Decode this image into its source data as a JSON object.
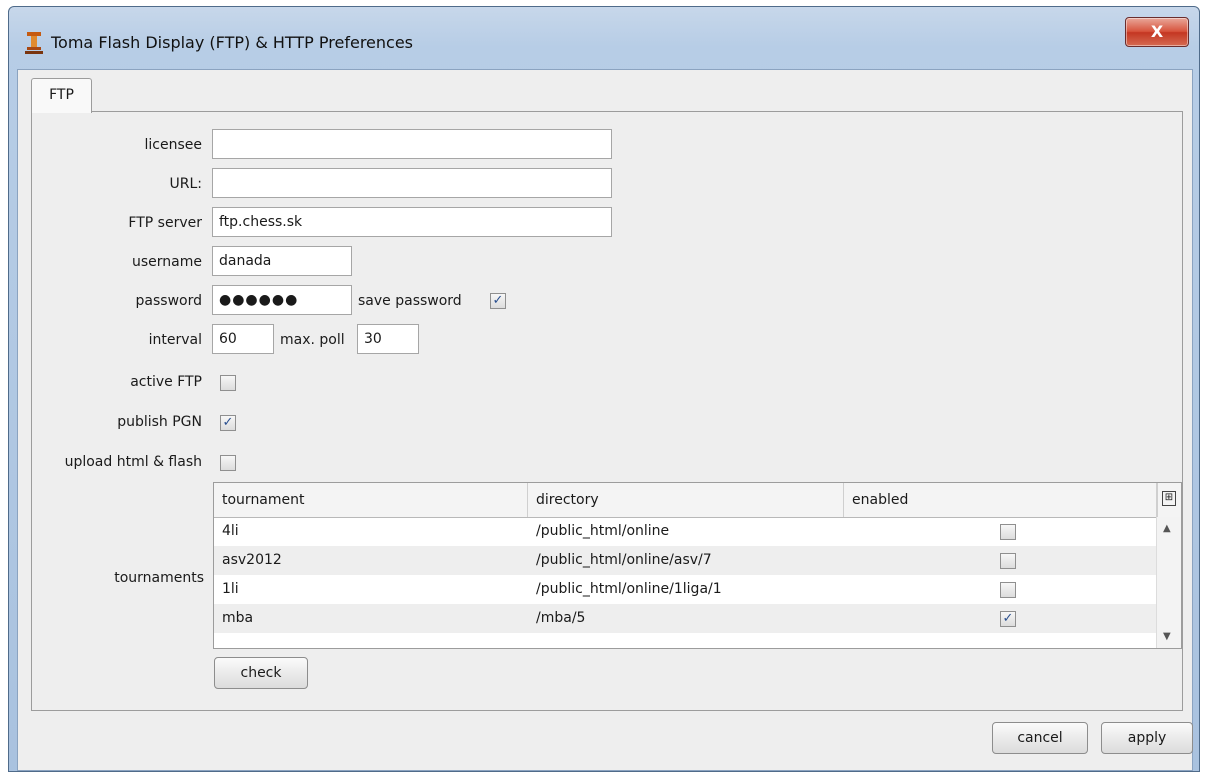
{
  "window": {
    "title": "Toma Flash Display (FTP) & HTTP Preferences",
    "close_label": "X"
  },
  "tabs": [
    {
      "label": "FTP"
    }
  ],
  "form": {
    "licensee_label": "licensee",
    "licensee_value": "",
    "url_label": "URL:",
    "url_value": "",
    "ftp_server_label": "FTP server",
    "ftp_server_value": "ftp.chess.sk",
    "username_label": "username",
    "username_value": "danada",
    "password_label": "password",
    "password_value": "●●●●●●",
    "save_password_label": "save password",
    "save_password_checked": true,
    "interval_label": "interval",
    "interval_value": "60",
    "max_poll_label": "max. poll",
    "max_poll_value": "30",
    "active_ftp_label": "active FTP",
    "active_ftp_checked": false,
    "publish_pgn_label": "publish PGN",
    "publish_pgn_checked": true,
    "upload_label": "upload html & flash",
    "upload_checked": false,
    "tournaments_label": "tournaments"
  },
  "table": {
    "columns": [
      "tournament",
      "directory",
      "enabled"
    ],
    "rows": [
      {
        "tournament": "4li",
        "directory": "/public_html/online",
        "enabled": false
      },
      {
        "tournament": "asv2012",
        "directory": "/public_html/online/asv/7",
        "enabled": false
      },
      {
        "tournament": "1li",
        "directory": "/public_html/online/1liga/1",
        "enabled": false
      },
      {
        "tournament": "mba",
        "directory": "/mba/5",
        "enabled": true
      }
    ]
  },
  "buttons": {
    "check": "check",
    "cancel": "cancel",
    "apply": "apply"
  },
  "check_mark": "✓"
}
